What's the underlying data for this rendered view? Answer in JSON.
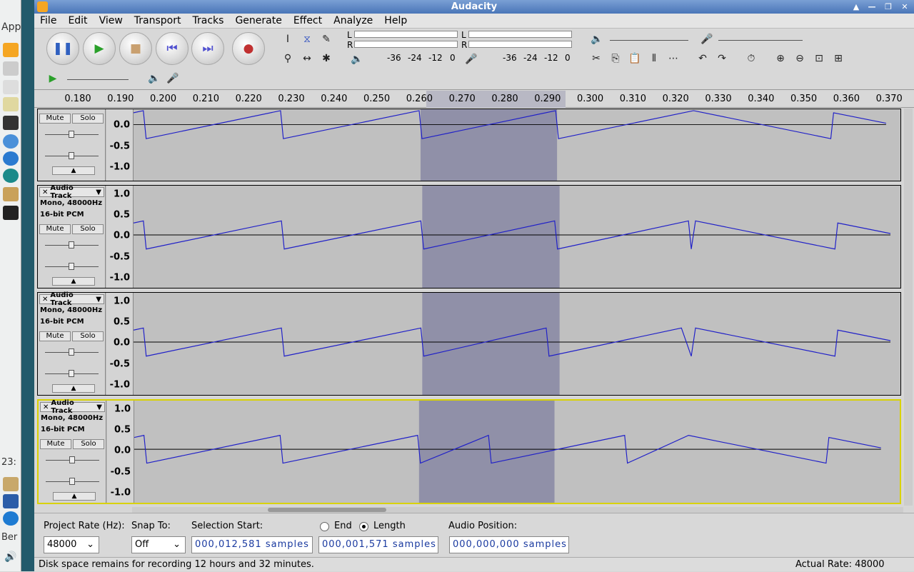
{
  "window": {
    "title": "Audacity"
  },
  "menu": [
    "File",
    "Edit",
    "View",
    "Transport",
    "Tracks",
    "Generate",
    "Effect",
    "Analyze",
    "Help"
  ],
  "transport": {
    "pause": "pause",
    "play": "play",
    "stop": "stop",
    "skip_start": "skip-to-start",
    "skip_end": "skip-to-end",
    "record": "record"
  },
  "meters": {
    "play_l": "L",
    "play_r": "R",
    "rec_l": "L",
    "rec_r": "R",
    "scale": [
      "-36",
      "-24",
      "-12",
      "0"
    ]
  },
  "ruler": [
    "0.180",
    "0.190",
    "0.200",
    "0.210",
    "0.220",
    "0.230",
    "0.240",
    "0.250",
    "0.260",
    "0.270",
    "0.280",
    "0.290",
    "0.300",
    "0.310",
    "0.320",
    "0.330",
    "0.340",
    "0.350",
    "0.360",
    "0.370"
  ],
  "tracks": [
    {
      "name": "",
      "format1": "",
      "format2": "",
      "mute": "Mute",
      "solo": "Solo",
      "selected": false
    },
    {
      "name": "Audio Track",
      "format1": "Mono, 48000Hz",
      "format2": "16-bit PCM",
      "mute": "Mute",
      "solo": "Solo",
      "selected": false
    },
    {
      "name": "Audio Track",
      "format1": "Mono, 48000Hz",
      "format2": "16-bit PCM",
      "mute": "Mute",
      "solo": "Solo",
      "selected": false
    },
    {
      "name": "Audio Track",
      "format1": "Mono, 48000Hz",
      "format2": "16-bit PCM",
      "mute": "Mute",
      "solo": "Solo",
      "selected": true
    }
  ],
  "vscale": [
    "1.0",
    "0.5",
    "0.0",
    "-0.5",
    "-1.0"
  ],
  "bottom": {
    "rate_label": "Project Rate (Hz):",
    "rate_value": "48000",
    "snap_label": "Snap To:",
    "snap_value": "Off",
    "sel_start_label": "Selection Start:",
    "sel_start_value": "000,012,581 samples",
    "end_label": "End",
    "length_label": "Length",
    "length_value": "000,001,571 samples",
    "audio_pos_label": "Audio Position:",
    "audio_pos_value": "000,000,000 samples"
  },
  "status": {
    "disk": "Disk space remains for recording 12 hours and 32 minutes.",
    "rate": "Actual Rate: 48000"
  },
  "desktop": {
    "app_label": "App",
    "clock": "23:",
    "user": "Ber"
  }
}
